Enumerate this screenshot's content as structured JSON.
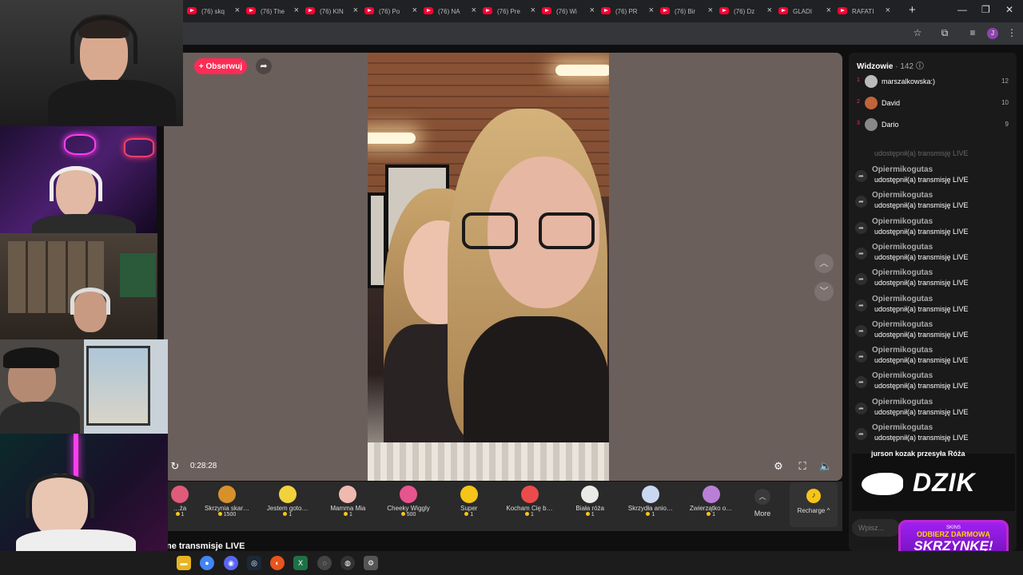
{
  "browser": {
    "tabs": [
      {
        "label": "(76) skq"
      },
      {
        "label": "(76) The"
      },
      {
        "label": "(76) KIN"
      },
      {
        "label": "(76) Po"
      },
      {
        "label": "(76) NA"
      },
      {
        "label": "(76) Pre"
      },
      {
        "label": "(76) Wi"
      },
      {
        "label": "(76) PR"
      },
      {
        "label": "(76) Bir"
      },
      {
        "label": "(76) Dz"
      },
      {
        "label": "GLADI"
      },
      {
        "label": "RAFATI"
      }
    ],
    "profile_initial": "J"
  },
  "player": {
    "follow_label": "+ Obserwuj",
    "elapsed": "0:28:28"
  },
  "gifts": [
    {
      "name": "…ża",
      "price": "1",
      "icon_color": "#e05a7a"
    },
    {
      "name": "Skrzynia skar…",
      "price": "1500",
      "icon_color": "#d7912b"
    },
    {
      "name": "Jestem goto…",
      "price": "1",
      "icon_color": "#f2d23c"
    },
    {
      "name": "Mamma Mia",
      "price": "1",
      "icon_color": "#f0b9b0"
    },
    {
      "name": "Cheeky Wiggly",
      "price": "500",
      "icon_color": "#e6558d"
    },
    {
      "name": "Super",
      "price": "1",
      "icon_color": "#f5c518"
    },
    {
      "name": "Kocham Cię b…",
      "price": "1",
      "icon_color": "#ec4b4b"
    },
    {
      "name": "Biała róża",
      "price": "1",
      "icon_color": "#e9ece6"
    },
    {
      "name": "Skrzydła anio…",
      "price": "1",
      "icon_color": "#c9d7f2"
    },
    {
      "name": "Zwierzątko o…",
      "price": "1",
      "icon_color": "#b97fd6"
    }
  ],
  "gift_bar": {
    "more_label": "More",
    "recharge_label": "Recharge ^"
  },
  "bottom_text": "ne transmisje LIVE",
  "viewers": {
    "title": "Widzowie",
    "count": "· 142",
    "list": [
      {
        "rank": "1",
        "name": "marszalkowska:)",
        "score": "12"
      },
      {
        "rank": "2",
        "name": "David",
        "score": "10"
      },
      {
        "rank": "3",
        "name": "Dario",
        "score": "9"
      }
    ]
  },
  "chat": {
    "partial_top": "udostępnił(a) transmisję LIVE",
    "messages": [
      {
        "user": "Opiermikogutas",
        "text": "udostępnił(a) transmisję LIVE"
      },
      {
        "user": "Opiermikogutas",
        "text": "udostępnił(a) transmisję LIVE"
      },
      {
        "user": "Opiermikogutas",
        "text": "udostępnił(a) transmisję LIVE"
      },
      {
        "user": "Opiermikogutas",
        "text": "udostępnił(a) transmisję LIVE"
      },
      {
        "user": "Opiermikogutas",
        "text": "udostępnił(a) transmisję LIVE"
      },
      {
        "user": "Opiermikogutas",
        "text": "udostępnił(a) transmisję LIVE"
      },
      {
        "user": "Opiermikogutas",
        "text": "udostępnił(a) transmisję LIVE"
      },
      {
        "user": "Opiermikogutas",
        "text": "udostępnił(a) transmisję LIVE"
      },
      {
        "user": "Opiermikogutas",
        "text": "udostępnił(a) transmisję LIVE"
      },
      {
        "user": "Opiermikogutas",
        "text": "udostępnił(a) transmisję LIVE"
      },
      {
        "user": "Opiermikogutas",
        "text": "udostępnił(a) transmisję LIVE"
      }
    ],
    "partial_bottom": "jurson kozak przesyła Róża",
    "input_placeholder": "Wpisz..."
  },
  "overlays": {
    "brand_logo": "DZIK",
    "promo_small": "SKINS",
    "promo_mid": "ODBIERZ DARMOWĄ",
    "promo_big": "SKRZYNKĘ!"
  },
  "colors": {
    "accent": "#fe2c55",
    "coin": "#f5c518",
    "promo_purple": "#a020f0"
  }
}
